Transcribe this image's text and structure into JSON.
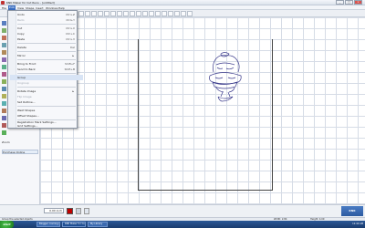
{
  "window": {
    "title": "KNK Maker for Cut Runs - [untitled]",
    "min": "_",
    "max": "□",
    "close": "×"
  },
  "menubar": [
    "File",
    "Edit",
    "View",
    "Shape",
    "Insert",
    "Windows",
    "Help"
  ],
  "edit_menu": {
    "items": [
      {
        "label": "Undo",
        "shortcut": "Ctrl+Z",
        "disabled": false
      },
      {
        "label": "Redo",
        "shortcut": "Ctrl+Y",
        "disabled": true
      },
      {
        "label": "Cut",
        "shortcut": "Ctrl+X",
        "disabled": false
      },
      {
        "label": "Copy",
        "shortcut": "Ctrl+C",
        "disabled": false
      },
      {
        "label": "Paste",
        "shortcut": "Ctrl+V",
        "disabled": false
      },
      {
        "label": "Delete",
        "shortcut": "Del",
        "disabled": false
      },
      {
        "label": "Mirror",
        "shortcut": "",
        "disabled": false,
        "submenu": true
      },
      {
        "label": "Bring to Front",
        "shortcut": "Shift+F",
        "disabled": false
      },
      {
        "label": "Send to Back",
        "shortcut": "Shift+B",
        "disabled": false
      },
      {
        "label": "Group",
        "shortcut": "",
        "disabled": false,
        "highlight": true
      },
      {
        "label": "Ungroup",
        "shortcut": "",
        "disabled": true
      },
      {
        "label": "Rotate Image",
        "shortcut": "",
        "disabled": false,
        "submenu": true
      },
      {
        "label": "Flip Image",
        "shortcut": "",
        "disabled": true
      },
      {
        "label": "Set Outline...",
        "shortcut": "",
        "disabled": false
      },
      {
        "label": "Weld Shapes",
        "shortcut": "",
        "disabled": false
      },
      {
        "label": "Offset Shapes...",
        "shortcut": "",
        "disabled": false
      },
      {
        "label": "Registration Mark Settings...",
        "shortcut": "",
        "disabled": false
      },
      {
        "label": "Grid Settings...",
        "shortcut": "",
        "disabled": false
      }
    ]
  },
  "left_panel": {
    "item1": "Zoom",
    "item2": "Purchase Online"
  },
  "bottom": {
    "size_value": "0.00 inch",
    "status": "Group the selected objects",
    "width": "Width: 2.84",
    "height": "Height: 4.09"
  },
  "taskbar": {
    "start": "start",
    "tasks": [
      "Blogger: Coming HOME",
      "KNK Maker for Cu...",
      "My Library"
    ],
    "clock": "11:40 AM"
  },
  "colors": {
    "accent": "#3a6ec2",
    "taskbar": "#2b5797",
    "swatch": "#c00000"
  }
}
